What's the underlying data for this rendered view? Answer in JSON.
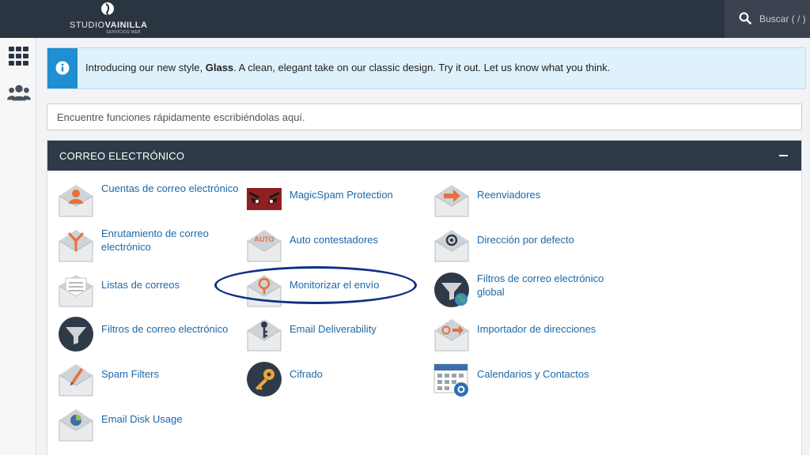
{
  "brand": {
    "name_light": "STUDIO",
    "name_bold": "VAINILLA",
    "sub": "SERVICIOS WEB"
  },
  "search": {
    "label": "Buscar ( / )"
  },
  "notice": {
    "prefix": "Introducing our new style, ",
    "bold": "Glass",
    "suffix": ". A clean, elegant take on our classic design. Try it out. Let us know what you think."
  },
  "quick_search": {
    "placeholder": "Encuentre funciones rápidamente escribiéndolas aquí."
  },
  "panel": {
    "title": "CORREO ELECTRÓNICO",
    "items": [
      {
        "id": "cuentas",
        "label": "Cuentas de correo electrónico",
        "icon": "email-accounts-icon"
      },
      {
        "id": "magicspam",
        "label": "MagicSpam Protection",
        "icon": "magicspam-icon"
      },
      {
        "id": "reenviadores",
        "label": "Reenviadores",
        "icon": "forwarders-icon"
      },
      {
        "id": "enrutamiento",
        "label": "Enrutamiento de correo electrónico",
        "icon": "email-routing-icon"
      },
      {
        "id": "autocontestadores",
        "label": "Auto contestadores",
        "icon": "autoresponders-icon",
        "icon_text": "AUTO"
      },
      {
        "id": "direccion-defecto",
        "label": "Dirección por defecto",
        "icon": "default-address-icon"
      },
      {
        "id": "listas",
        "label": "Listas de correos",
        "icon": "mailing-lists-icon"
      },
      {
        "id": "monitorizar",
        "label": "Monitorizar el envío",
        "icon": "track-delivery-icon"
      },
      {
        "id": "filtros-global",
        "label": "Filtros de correo electrónico global",
        "icon": "global-email-filters-icon"
      },
      {
        "id": "filtros",
        "label": "Filtros de correo electrónico",
        "icon": "email-filters-icon"
      },
      {
        "id": "deliverability",
        "label": "Email Deliverability",
        "icon": "email-deliverability-icon"
      },
      {
        "id": "importador",
        "label": "Importador de direcciones",
        "icon": "address-importer-icon"
      },
      {
        "id": "spam",
        "label": "Spam Filters",
        "icon": "spam-filters-icon"
      },
      {
        "id": "cifrado",
        "label": "Cifrado",
        "icon": "encryption-icon"
      },
      {
        "id": "calendarios",
        "label": "Calendarios y Contactos",
        "icon": "calendars-contacts-icon"
      },
      {
        "id": "disk-usage",
        "label": "Email Disk Usage",
        "icon": "email-disk-usage-icon"
      }
    ]
  },
  "colors": {
    "topbar": "#2b3441",
    "panel_header": "#2f3a48",
    "link": "#1d68a6",
    "accent_orange": "#e8703a",
    "info_blue": "#1f8fd1",
    "highlight": "#0f2f86"
  }
}
